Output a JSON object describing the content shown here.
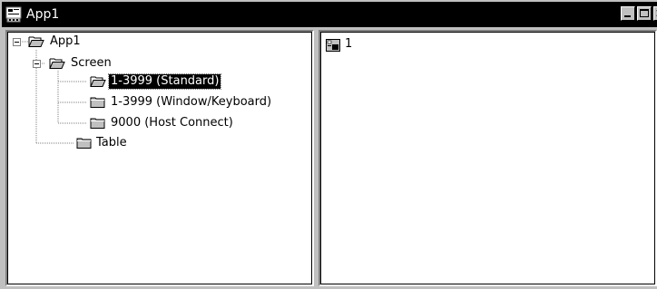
{
  "window": {
    "title": "App1",
    "icon_name": "app-document-icon",
    "colors": {
      "titlebar": "#000000",
      "face": "#c0c0c0",
      "selection": "#000000"
    }
  },
  "controls": {
    "minimize": "minimize-icon",
    "maximize": "maximize-icon",
    "close": "close-icon"
  },
  "tree": {
    "root": {
      "label": "App1",
      "expanded": true
    },
    "screen": {
      "label": "Screen",
      "expanded": true
    },
    "screen_children": [
      {
        "label": "1-3999 (Standard)",
        "selected": true
      },
      {
        "label": "1-3999 (Window/Keyboard)",
        "selected": false
      },
      {
        "label": "9000 (Host Connect)",
        "selected": false
      }
    ],
    "table": {
      "label": "Table"
    }
  },
  "list": {
    "items": [
      {
        "label": "1",
        "icon_name": "screen-item-icon"
      }
    ]
  }
}
